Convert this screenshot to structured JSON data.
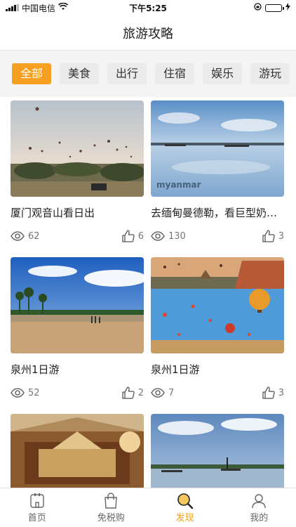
{
  "status_bar": {
    "carrier": "中国电信",
    "time": "下午5:25"
  },
  "nav": {
    "title": "旅游攻略"
  },
  "categories": [
    "全部",
    "美食",
    "出行",
    "住宿",
    "娱乐",
    "游玩"
  ],
  "active_category": "全部",
  "cards": [
    {
      "title": "厦门观音山看日出",
      "views": "62",
      "likes": "6",
      "image": "balloons-over-field"
    },
    {
      "title": "去缅甸曼德勒，看巨型奶…",
      "views": "130",
      "likes": "3",
      "image": "lake-reflection",
      "image_text": [
        "myanmar"
      ]
    },
    {
      "title": "泉州1日游",
      "views": "52",
      "likes": "2",
      "image": "beach-palms"
    },
    {
      "title": "泉州1日游",
      "views": "7",
      "likes": "3",
      "image": "bagan-balloons"
    },
    {
      "title": "",
      "views": "",
      "likes": "",
      "image": "temple-interior"
    },
    {
      "title": "",
      "views": "",
      "likes": "",
      "image": "lake-boats"
    }
  ],
  "tab_bar": {
    "items": [
      {
        "label": "首页",
        "icon": "home-icon"
      },
      {
        "label": "免税购",
        "icon": "shopping-bag-icon"
      },
      {
        "label": "发现",
        "icon": "discover-search-icon"
      },
      {
        "label": "我的",
        "icon": "profile-icon"
      }
    ],
    "active": "发现"
  },
  "colors": {
    "accent": "#f5a021",
    "tab_bg": "#ebebeb",
    "battery": "#2ec84a"
  }
}
